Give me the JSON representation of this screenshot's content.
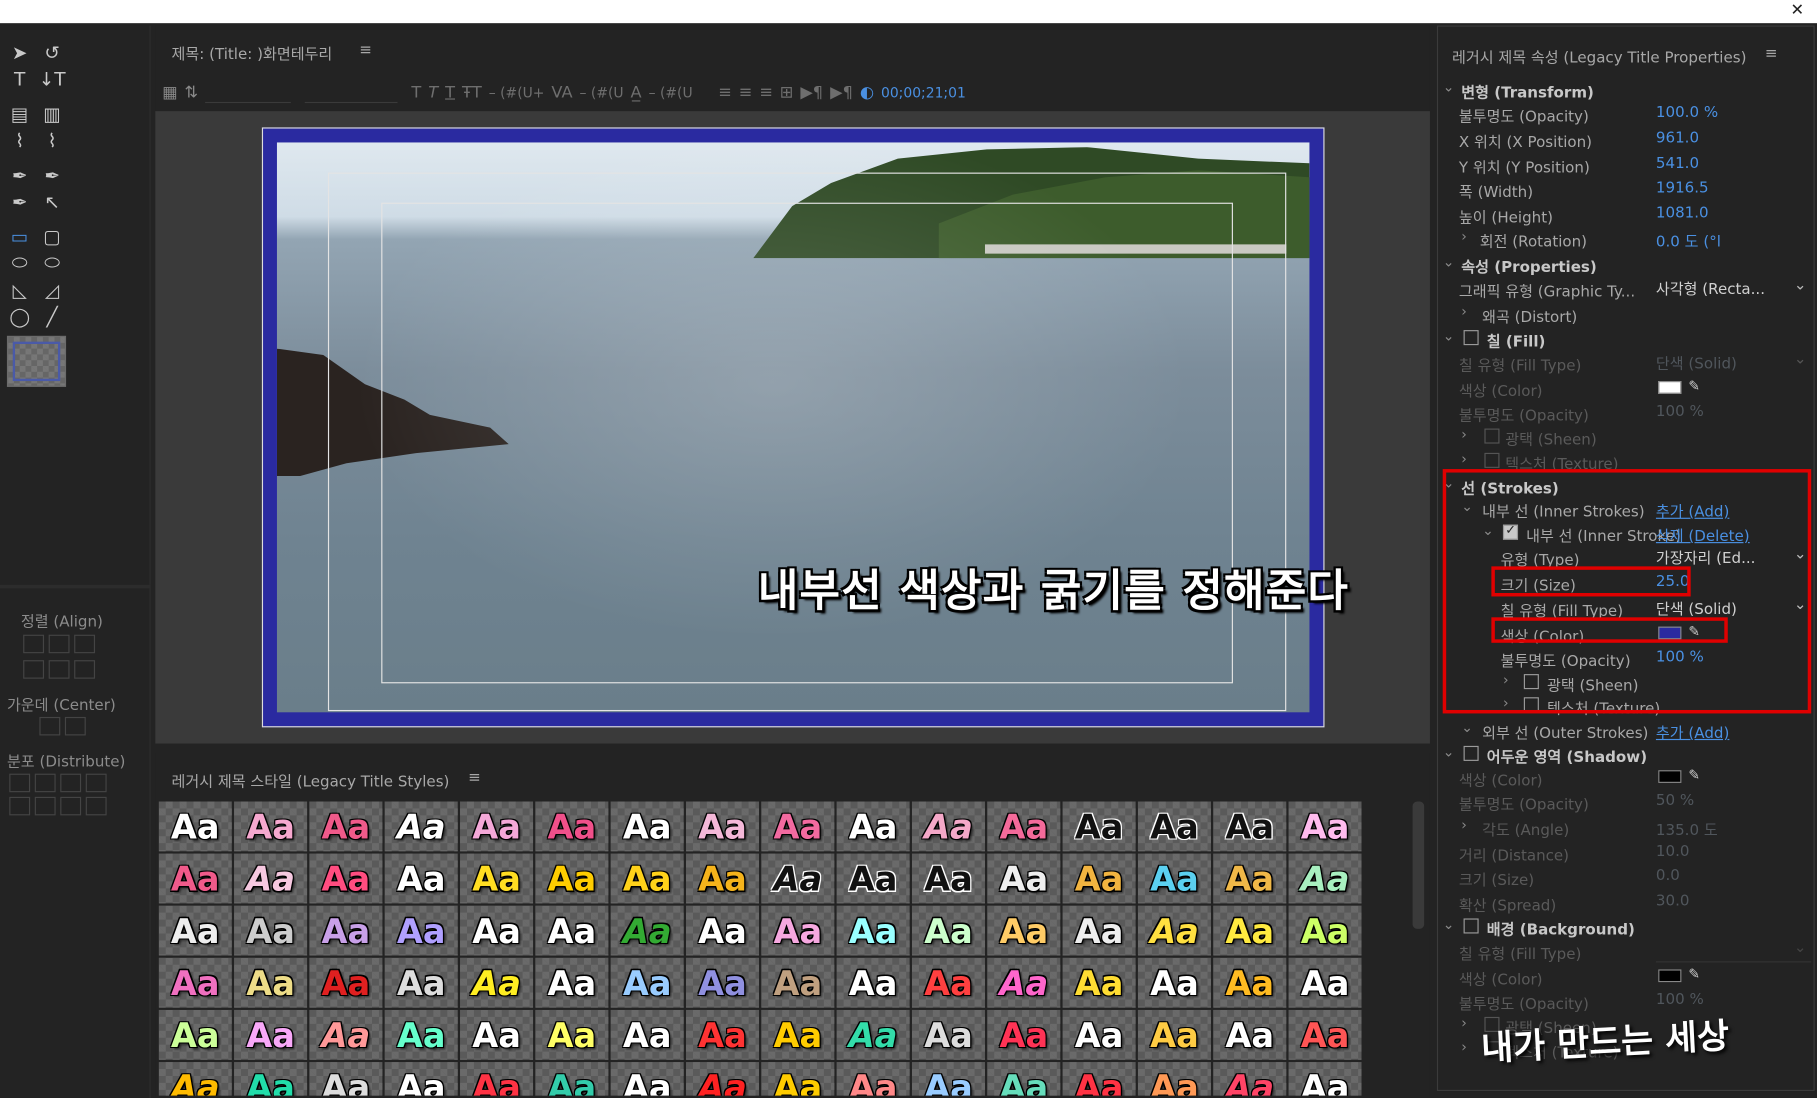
{
  "window": {
    "close_glyph": "✕"
  },
  "tools": {
    "icons": [
      "selection-tool-icon",
      "rotation-tool-icon",
      "type-tool-icon",
      "vertical-type-tool-icon",
      "area-type-tool-icon",
      "vertical-area-type-tool-icon",
      "path-type-tool-icon",
      "vertical-path-type-tool-icon",
      "pen-tool-icon",
      "delete-anchor-point-tool-icon",
      "add-anchor-point-tool-icon",
      "convert-anchor-point-tool-icon",
      "rectangle-tool-icon",
      "rounded-rectangle-tool-icon",
      "clipped-corner-rectangle-tool-icon",
      "rounded-corner-rectangle-tool-icon",
      "wedge-tool-icon",
      "arc-tool-icon",
      "ellipse-tool-icon",
      "line-tool-icon"
    ],
    "glyphs": [
      "➤",
      "↺",
      "T",
      "↓T",
      "▤",
      "▥",
      "⌇",
      "⌇",
      "✒",
      "✒",
      "✒",
      "↖",
      "▭",
      "▢",
      "⬭",
      "⬭",
      "◺",
      "◿",
      "◯",
      "╱"
    ],
    "align_label": "정렬 (Align)",
    "center_label": "가운데 (Center)",
    "distribute_label": "분포 (Distribute)"
  },
  "title_panel": {
    "title": "제목: (Title: )화면테두리",
    "menu_glyph": "≡",
    "toolbar": {
      "timecode": "00;00;21;01",
      "kern": "– (#(U+",
      "track": "– (#(U",
      "lead": "– (#(U"
    },
    "caption": "내부선 색상과 굵기를 정해준다"
  },
  "styles_panel": {
    "title": "레거시 제목 스타일 (Legacy Title Styles)",
    "swatch_text": "Aa",
    "swatch_colors": [
      "#fff",
      "#f6a8cf",
      "#f05a8a",
      "#fff",
      "#f4a8d8",
      "#f0508a",
      "#fff",
      "#f4b8d8",
      "#f26aa0",
      "#fff",
      "#f4a8c8",
      "#f46a9a",
      "#111",
      "#111",
      "#111",
      "#fbe",
      "#f05a8a",
      "#f6c8e0",
      "#ff4d80",
      "#fff",
      "#ffdd22",
      "#ffcc00",
      "#ffd21a",
      "#f5b31b",
      "#111",
      "#111",
      "#111",
      "#eee",
      "#f2b440",
      "#5bd0f0",
      "#f0b848",
      "#a8f0c0",
      "#eee",
      "#ccc",
      "#c8a0e8",
      "#b0a0ff",
      "#fff",
      "#fff",
      "#3a3",
      "#fff",
      "#f6a8e0",
      "#9ff",
      "#cfc",
      "#ffcc66",
      "#eee",
      "#ffe040",
      "#ffea40",
      "#ccff66",
      "#f070c0",
      "#eedd88",
      "#e02020",
      "#ddd",
      "#ffee22",
      "#fff",
      "#99ccff",
      "#9090e0",
      "#c0a080",
      "#fff",
      "#ff4040",
      "#ff66cc",
      "#ffdd33",
      "#fff",
      "#ffbb22",
      "#fff",
      "#ccff99",
      "#f8a8f8",
      "#ff9999",
      "#66ffcc",
      "#fff",
      "#ffff66",
      "#fff",
      "#ff3333",
      "#ffcc00",
      "#33ddaa",
      "#ddd",
      "#ff3355",
      "#fff",
      "#ffcc44",
      "#fff",
      "#ff5555",
      "#ffbb00",
      "#22ddaa",
      "#ddd",
      "#fff",
      "#ff3344",
      "#33ccaa",
      "#fff",
      "#ff2222",
      "#ffcc00",
      "#ff8888",
      "#99ccff",
      "#66ddbb",
      "#ff3344",
      "#ff9955",
      "#ff4466",
      "#fff"
    ]
  },
  "props": {
    "title": "레거시 제목 속성 (Legacy Title Properties)",
    "transform": "변형 (Transform)",
    "opacity": "불투명도 (Opacity)",
    "opacity_v": "100.0 %",
    "xpos": "X 위치 (X Position)",
    "xpos_v": "961.0",
    "ypos": "Y 위치 (Y Position)",
    "ypos_v": "541.0",
    "width": "폭 (Width)",
    "width_v": "1916.5",
    "height": "높이 (Height)",
    "height_v": "1081.0",
    "rotation": "회전 (Rotation)",
    "rotation_v": "0.0 도 (°l",
    "properties": "속성 (Properties)",
    "graphic_type": "그래픽 유형 (Graphic Ty...",
    "graphic_type_v": "사각형 (Recta...",
    "distort": "왜곡 (Distort)",
    "fill": "칠 (Fill)",
    "fill_type": "칠 유형 (Fill Type)",
    "fill_type_v": "단색 (Solid)",
    "fill_color": "색상 (Color)",
    "fill_opacity": "불투명도 (Opacity)",
    "fill_opacity_v": "100 %",
    "sheen": "광택 (Sheen)",
    "texture": "텍스처 (Texture)",
    "strokes": "선 (Strokes)",
    "inner_strokes": "내부 선 (Inner Strokes)",
    "add": "추가 (Add)",
    "inner_stroke": "내부 선 (Inner Stroke)",
    "delete": "삭제 (Delete)",
    "type": "유형 (Type)",
    "type_v": "가장자리 (Ed...",
    "size": "크기 (Size)",
    "size_v": "25.0",
    "s_fill_type": "칠 유형 (Fill Type)",
    "s_fill_type_v": "단색 (Solid)",
    "s_color": "색상 (Color)",
    "s_opacity": "불투명도 (Opacity)",
    "s_opacity_v": "100 %",
    "s_sheen": "광택 (Sheen)",
    "s_texture": "텍스처 (Texture)",
    "outer_strokes": "외부 선 (Outer Strokes)",
    "add2": "추가 (Add)",
    "shadow": "어두운 영역 (Shadow)",
    "sh_color": "색상 (Color)",
    "sh_opacity": "불투명도 (Opacity)",
    "sh_opacity_v": "50 %",
    "sh_angle": "각도 (Angle)",
    "sh_angle_v": "135.0 도",
    "sh_distance": "거리 (Distance)",
    "sh_distance_v": "10.0",
    "sh_size": "크기 (Size)",
    "sh_size_v": "0.0",
    "sh_spread": "확산 (Spread)",
    "sh_spread_v": "30.0",
    "background": "배경 (Background)",
    "bg_fill_type": "칠 유형 (Fill Type)",
    "bg_color": "색상 (Color)",
    "bg_opacity": "불투명도 (Opacity)",
    "bg_opacity_v": "100 %",
    "bg_sheen": "광택 (Sheen)",
    "bg_texture": "텍스처 (Texture)"
  },
  "colors": {
    "accent": "#4a90e2",
    "stroke_color": "#2a2aa0",
    "fill_color": "#ffffff",
    "shadow_color": "#000000",
    "highlight": "#e00000"
  },
  "watermark": "내가 만드는 세상"
}
